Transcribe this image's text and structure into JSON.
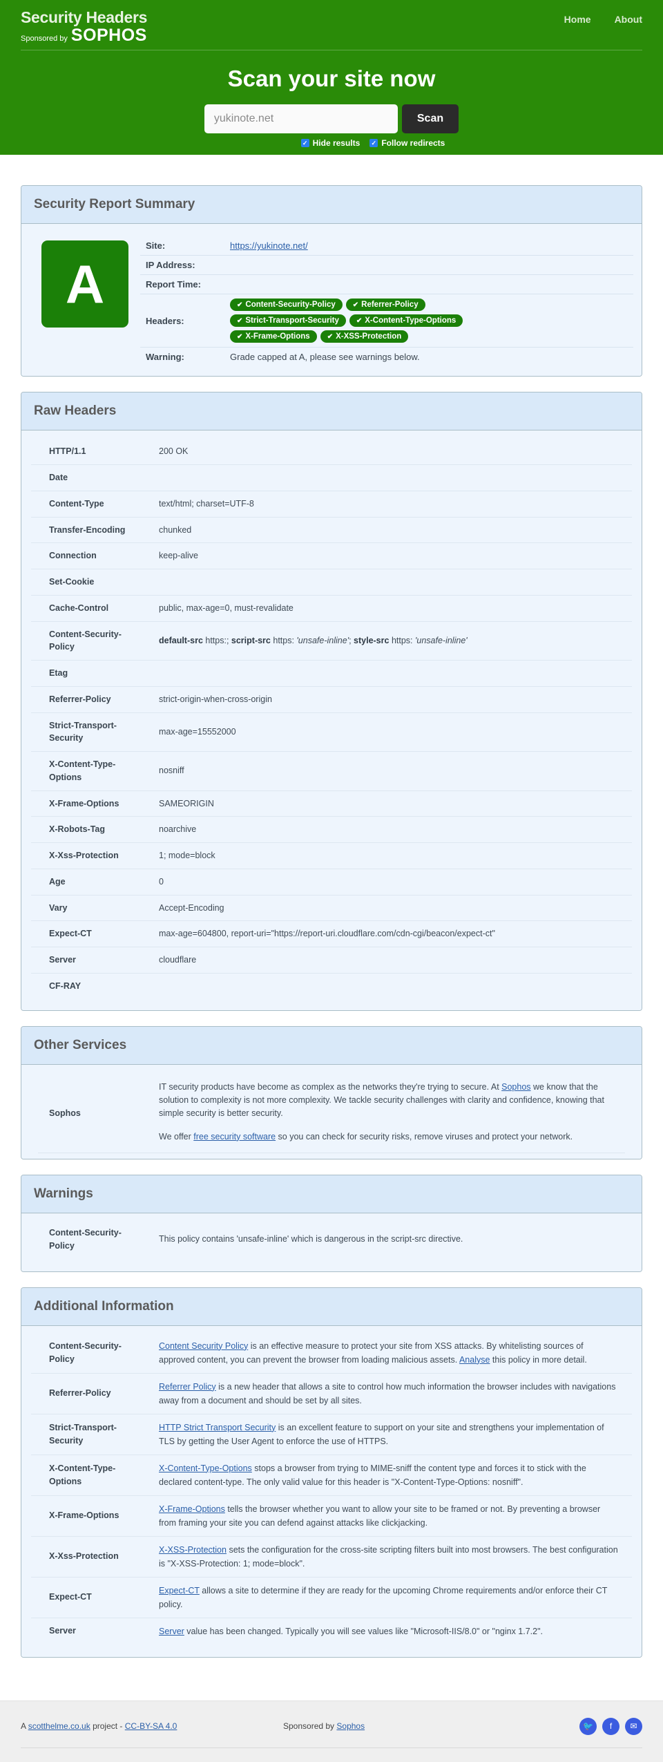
{
  "header": {
    "brand_title": "Security Headers",
    "sponsored_by": "Sponsored by",
    "sponsor_logo": "SOPHOS",
    "nav": [
      {
        "label": "Home"
      },
      {
        "label": "About"
      }
    ],
    "hero_title": "Scan your site now",
    "scan_input_value": "yukinote.net",
    "scan_input_placeholder": "yukinote.net",
    "scan_button": "Scan",
    "options": [
      {
        "label": "Hide results",
        "checked": true
      },
      {
        "label": "Follow redirects",
        "checked": true
      }
    ],
    "checkbox_color": "#2a7ef0",
    "background_color": "#2a8b08"
  },
  "summary": {
    "panel_title": "Security Report Summary",
    "grade": "A",
    "grade_color": "#1b8008",
    "rows": {
      "site_label": "Site:",
      "site_value": "https://yukinote.net/",
      "ip_label": "IP Address:",
      "ip_value": "",
      "report_time_label": "Report Time:",
      "report_time_value": "",
      "headers_label": "Headers:",
      "warning_label": "Warning:",
      "warning_value": "Grade capped at A, please see warnings below."
    },
    "header_badges": [
      "Content-Security-Policy",
      "Referrer-Policy",
      "Strict-Transport-Security",
      "X-Content-Type-Options",
      "X-Frame-Options",
      "X-XSS-Protection"
    ]
  },
  "raw_headers": {
    "panel_title": "Raw Headers",
    "rows": [
      {
        "name": "HTTP/1.1",
        "value": "200 OK",
        "style": "plain"
      },
      {
        "name": "Date",
        "value": "",
        "style": "plain"
      },
      {
        "name": "Content-Type",
        "value": "text/html; charset=UTF-8",
        "style": "plain"
      },
      {
        "name": "Transfer-Encoding",
        "value": "chunked",
        "style": "plain"
      },
      {
        "name": "Connection",
        "value": "keep-alive",
        "style": "plain"
      },
      {
        "name": "Set-Cookie",
        "value": "",
        "style": "plain"
      },
      {
        "name": "Cache-Control",
        "value": "public, max-age=0, must-revalidate",
        "style": "plain"
      },
      {
        "name": "Content-Security-Policy",
        "value": "default-src https:; script-src https: 'unsafe-inline'; style-src https: 'unsafe-inline'",
        "style": "green",
        "rich": "csp"
      },
      {
        "name": "Etag",
        "value": "",
        "style": "plain"
      },
      {
        "name": "Referrer-Policy",
        "value": "strict-origin-when-cross-origin",
        "style": "green"
      },
      {
        "name": "Strict-Transport-Security",
        "value": "max-age=15552000",
        "style": "green"
      },
      {
        "name": "X-Content-Type-Options",
        "value": "nosniff",
        "style": "green"
      },
      {
        "name": "X-Frame-Options",
        "value": "SAMEORIGIN",
        "style": "green"
      },
      {
        "name": "X-Robots-Tag",
        "value": "noarchive",
        "style": "plain"
      },
      {
        "name": "X-Xss-Protection",
        "value": "1; mode=block",
        "style": "green"
      },
      {
        "name": "Age",
        "value": "0",
        "style": "plain"
      },
      {
        "name": "Vary",
        "value": "Accept-Encoding",
        "style": "plain"
      },
      {
        "name": "Expect-CT",
        "value": "max-age=604800, report-uri=\"https://report-uri.cloudflare.com/cdn-cgi/beacon/expect-ct\"",
        "style": "blue"
      },
      {
        "name": "Server",
        "value": "cloudflare",
        "style": "green"
      },
      {
        "name": "CF-RAY",
        "value": "",
        "style": "plain"
      }
    ],
    "csp_parts": {
      "d1": "default-src",
      "t1": " https:; ",
      "d2": "script-src",
      "t2": " https: ",
      "q1": "'unsafe-inline'",
      "t3": "; ",
      "d3": "style-src",
      "t4": " https: ",
      "q2": "'unsafe-inline'"
    }
  },
  "other_services": {
    "panel_title": "Other Services",
    "provider": "Sophos",
    "para1_a": "IT security products have become as complex as the networks they're trying to secure. At ",
    "para1_link": "Sophos",
    "para1_b": " we know that the solution to complexity is not more complexity. We tackle security challenges with clarity and confidence, knowing that simple security is better security.",
    "para2_a": "We offer ",
    "para2_link": "free security software",
    "para2_b": " so you can check for security risks, remove viruses and protect your network."
  },
  "warnings": {
    "panel_title": "Warnings",
    "rows": [
      {
        "name": "Content-Security-Policy",
        "text": "This policy contains 'unsafe-inline' which is dangerous in the script-src directive."
      }
    ]
  },
  "additional_information": {
    "panel_title": "Additional Information",
    "rows": [
      {
        "name": "Content-Security-Policy",
        "style": "green",
        "link1": "Content Security Policy",
        "text1": " is an effective measure to protect your site from XSS attacks. By whitelisting sources of approved content, you can prevent the browser from loading malicious assets. ",
        "link2": "Analyse",
        "text2": " this policy in more detail."
      },
      {
        "name": "Referrer-Policy",
        "style": "green",
        "link1": "Referrer Policy",
        "text1": " is a new header that allows a site to control how much information the browser includes with navigations away from a document and should be set by all sites.",
        "link2": "",
        "text2": ""
      },
      {
        "name": "Strict-Transport-Security",
        "style": "green",
        "link1": "HTTP Strict Transport Security",
        "text1": " is an excellent feature to support on your site and strengthens your implementation of TLS by getting the User Agent to enforce the use of HTTPS.",
        "link2": "",
        "text2": ""
      },
      {
        "name": "X-Content-Type-Options",
        "style": "green",
        "link1": "X-Content-Type-Options",
        "text1": " stops a browser from trying to MIME-sniff the content type and forces it to stick with the declared content-type. The only valid value for this header is \"X-Content-Type-Options: nosniff\".",
        "link2": "",
        "text2": ""
      },
      {
        "name": "X-Frame-Options",
        "style": "green",
        "link1": "X-Frame-Options",
        "text1": " tells the browser whether you want to allow your site to be framed or not. By preventing a browser from framing your site you can defend against attacks like clickjacking.",
        "link2": "",
        "text2": ""
      },
      {
        "name": "X-Xss-Protection",
        "style": "green",
        "link1": "X-XSS-Protection",
        "text1": " sets the configuration for the cross-site scripting filters built into most browsers. The best configuration is \"X-XSS-Protection: 1; mode=block\".",
        "link2": "",
        "text2": ""
      },
      {
        "name": "Expect-CT",
        "style": "blue",
        "link1": "Expect-CT",
        "text1": " allows a site to determine if they are ready for the upcoming Chrome requirements and/or enforce their CT policy.",
        "link2": "",
        "text2": ""
      },
      {
        "name": "Server",
        "style": "green",
        "link1": "Server",
        "text1": " value has been changed. Typically you will see values like \"Microsoft-IIS/8.0\" or \"nginx 1.7.2\".",
        "link2": "",
        "text2": ""
      }
    ]
  },
  "footer": {
    "left_a": "A ",
    "left_link1": "scotthelme.co.uk",
    "left_b": " project - ",
    "left_link2": "CC-BY-SA 4.0",
    "mid_a": "Sponsored by ",
    "mid_link": "Sophos",
    "social": [
      {
        "icon": "twitter-icon",
        "glyph": "🐦"
      },
      {
        "icon": "facebook-icon",
        "glyph": "f"
      },
      {
        "icon": "email-icon",
        "glyph": "✉"
      }
    ]
  }
}
